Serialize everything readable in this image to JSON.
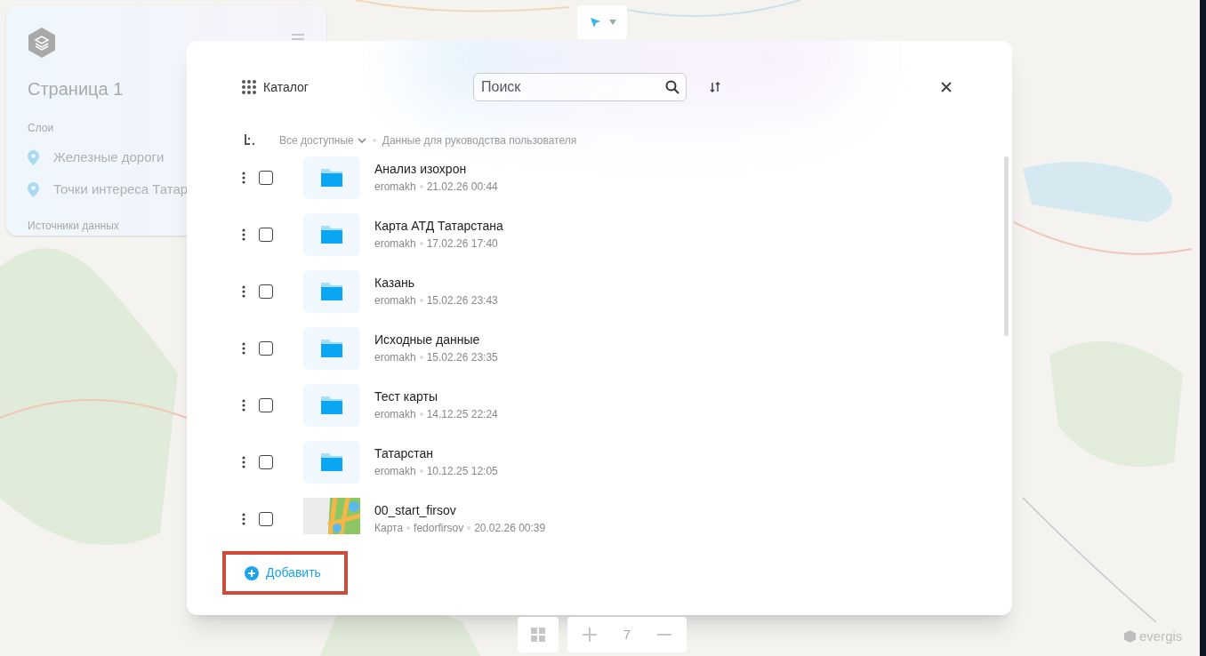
{
  "map": {
    "zoom_level": "7",
    "logo": "evergis"
  },
  "sidebar": {
    "title": "Страница 1",
    "layers_heading": "Слои",
    "layers": [
      {
        "name": "Железные дороги"
      },
      {
        "name": "Точки интереса Татар"
      }
    ],
    "sources_heading": "Источники данных"
  },
  "catalog": {
    "title": "Каталог",
    "search": {
      "placeholder": "Поиск"
    },
    "filter": "Все доступные",
    "breadcrumb": "Данные для руководства пользователя",
    "items": [
      {
        "kind": "folder",
        "name": "Анализ изохрон",
        "author": "eromakh",
        "date": "21.02.26 00:44",
        "checked": false
      },
      {
        "kind": "folder",
        "name": "Карта АТД Татарстана",
        "author": "eromakh",
        "date": "17.02.26 17:40",
        "checked": false
      },
      {
        "kind": "folder",
        "name": "Казань",
        "author": "eromakh",
        "date": "15.02.26 23:43",
        "checked": false
      },
      {
        "kind": "folder",
        "name": "Исходные данные",
        "author": "eromakh",
        "date": "15.02.26 23:35",
        "checked": false
      },
      {
        "kind": "folder",
        "name": "Тест карты",
        "author": "eromakh",
        "date": "14.12.25 22:24",
        "checked": false
      },
      {
        "kind": "folder",
        "name": "Татарстан",
        "author": "eromakh",
        "date": "10.12.25 12:05",
        "checked": false
      },
      {
        "kind": "map",
        "type": "Карта",
        "name": "00_start_firsov",
        "author": "fedorfirsov",
        "date": "20.02.26 00:39",
        "checked": false
      }
    ],
    "add_button": "Добавить"
  }
}
